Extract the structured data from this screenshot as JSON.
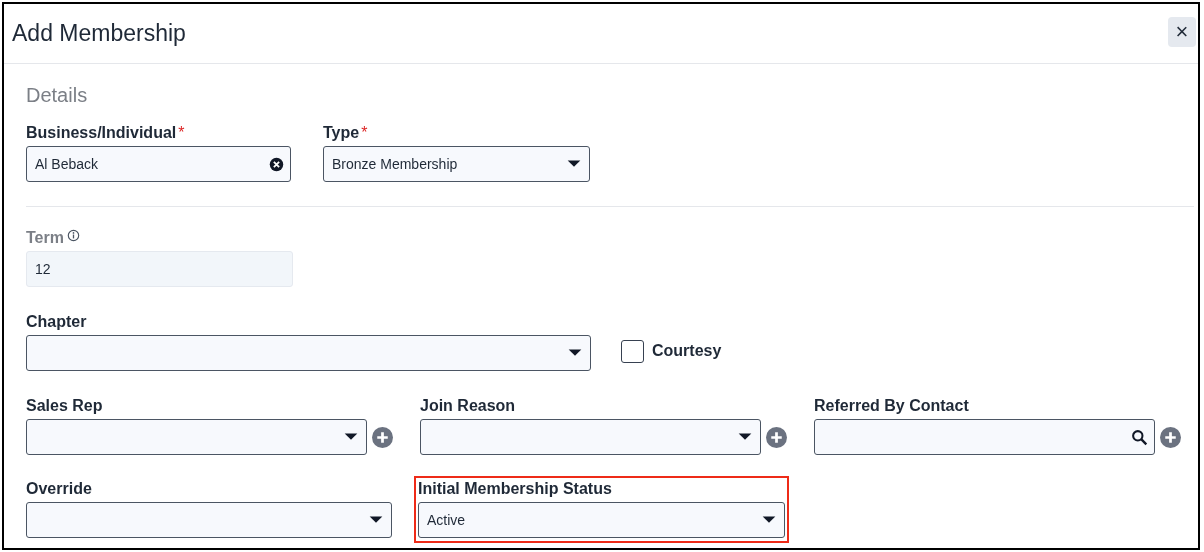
{
  "window": {
    "title": "Add Membership",
    "close": "×"
  },
  "section": {
    "heading": "Details"
  },
  "rows": [
    [
      {
        "kind": "clearable",
        "label": "Business/Individual",
        "required_mark": "*",
        "value": "Al Beback"
      },
      {
        "kind": "select",
        "label": "Type",
        "required_mark": "*",
        "value": "Bronze Membership"
      }
    ],
    [
      {
        "kind": "readonly",
        "label": "Term",
        "info": true,
        "value": "12"
      }
    ],
    [
      {
        "kind": "select",
        "label": "Chapter"
      },
      {
        "kind": "checkbox",
        "label": "Courtesy",
        "checked": false
      }
    ],
    [
      {
        "kind": "select",
        "label": "Sales Rep",
        "add_button": true
      },
      {
        "kind": "select",
        "label": "Join Reason",
        "add_button": true
      },
      {
        "kind": "lookup",
        "label": "Referred By Contact",
        "add_button": true
      }
    ],
    [
      {
        "kind": "select",
        "label": "Override"
      },
      {
        "kind": "select",
        "label": "Initial Membership Status",
        "value": "Active",
        "highlighted": true
      }
    ]
  ]
}
